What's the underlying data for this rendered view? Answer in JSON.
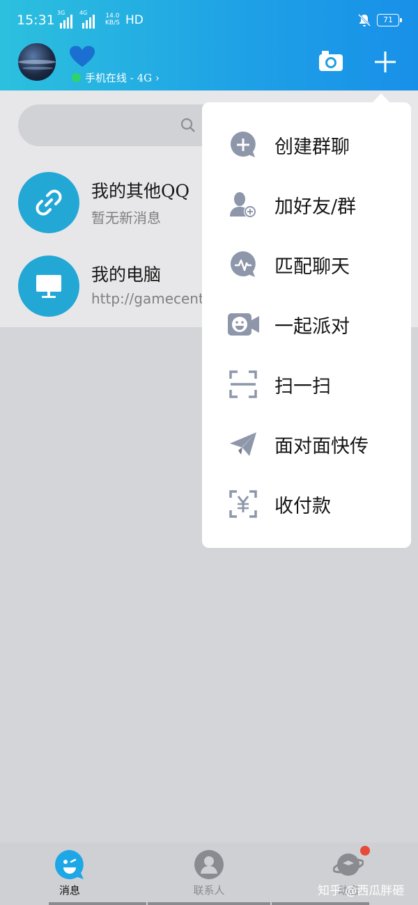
{
  "status_bar": {
    "time": "15:31",
    "signal1_label": "3G",
    "signal2_label": "4G",
    "speed_value": "14.0",
    "speed_unit": "KB/S",
    "hd": "HD",
    "battery": "71"
  },
  "header": {
    "online_status": "手机在线 - 4G",
    "online_chevron": "›",
    "icons": {
      "camera": "camera-icon",
      "add": "plus-icon",
      "status_emblem": "blue-heart-icon"
    },
    "colors": {
      "gradient_start": "#2cc0de",
      "gradient_end": "#1890e8",
      "online_dot": "#2fd36b"
    }
  },
  "search": {
    "placeholder": ""
  },
  "conversations": [
    {
      "title": "我的其他QQ",
      "subtitle": "暂无新消息",
      "icon": "link-icon"
    },
    {
      "title": "我的电脑",
      "subtitle": "http://gamecent",
      "icon": "monitor-icon"
    }
  ],
  "popup_menu": {
    "items": [
      {
        "label": "创建群聊",
        "icon": "create-group-chat-icon"
      },
      {
        "label": "加好友/群",
        "icon": "add-friend-icon"
      },
      {
        "label": "匹配聊天",
        "icon": "match-chat-icon"
      },
      {
        "label": "一起派对",
        "icon": "party-video-icon"
      },
      {
        "label": "扫一扫",
        "icon": "scan-icon"
      },
      {
        "label": "面对面快传",
        "icon": "face-to-face-transfer-icon"
      },
      {
        "label": "收付款",
        "icon": "payment-icon"
      }
    ]
  },
  "tabbar": {
    "tabs": [
      {
        "label": "消息",
        "icon": "messages-icon",
        "active": true
      },
      {
        "label": "联系人",
        "icon": "contacts-icon",
        "active": false
      },
      {
        "label": "动态",
        "icon": "planet-icon",
        "active": false
      }
    ],
    "badge_color": "#e84a3a"
  },
  "watermark": "知乎 @西瓜胖砸",
  "colors": {
    "accent": "#23a8d6",
    "menu_icon": "#8e96aa"
  }
}
